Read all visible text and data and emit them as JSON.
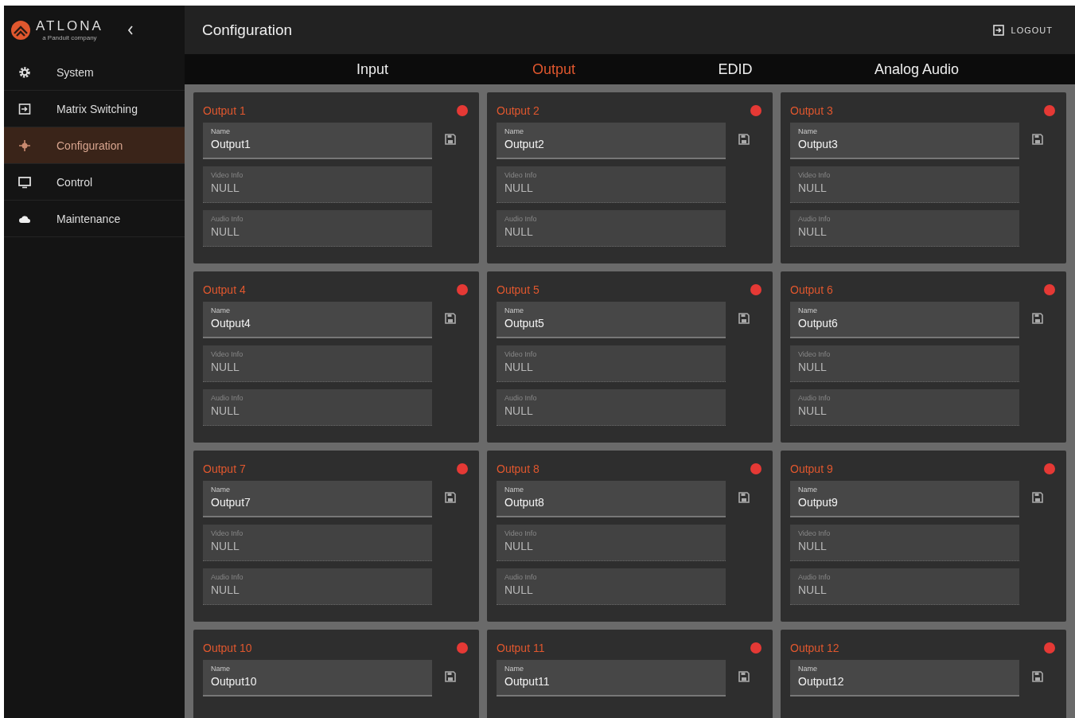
{
  "brand": {
    "name": "ATLONA",
    "tagline": "a Panduit company"
  },
  "sidebar": {
    "items": [
      {
        "label": "System",
        "selected": false
      },
      {
        "label": "Matrix Switching",
        "selected": false
      },
      {
        "label": "Configuration",
        "selected": true
      },
      {
        "label": "Control",
        "selected": false
      },
      {
        "label": "Maintenance",
        "selected": false
      }
    ]
  },
  "header": {
    "title": "Configuration",
    "logout": "LOGOUT"
  },
  "tabs": [
    {
      "label": "Input",
      "selected": false
    },
    {
      "label": "Output",
      "selected": true
    },
    {
      "label": "EDID",
      "selected": false
    },
    {
      "label": "Analog Audio",
      "selected": false
    }
  ],
  "outputs": [
    {
      "title": "Output 1",
      "color": "#e53935",
      "fields": [
        {
          "label": "Name",
          "value": "Output1",
          "disabled": false
        },
        {
          "label": "Video Info",
          "value": "NULL",
          "disabled": true
        },
        {
          "label": "Audio Info",
          "value": "NULL",
          "disabled": true
        }
      ]
    },
    {
      "title": "Output 2",
      "color": "#e53935",
      "fields": [
        {
          "label": "Name",
          "value": "Output2",
          "disabled": false
        },
        {
          "label": "Video Info",
          "value": "NULL",
          "disabled": true
        },
        {
          "label": "Audio Info",
          "value": "NULL",
          "disabled": true
        }
      ]
    },
    {
      "title": "Output 3",
      "color": "#e53935",
      "fields": [
        {
          "label": "Name",
          "value": "Output3",
          "disabled": false
        },
        {
          "label": "Video Info",
          "value": "NULL",
          "disabled": true
        },
        {
          "label": "Audio Info",
          "value": "NULL",
          "disabled": true
        }
      ]
    },
    {
      "title": "Output 4",
      "color": "#e53935",
      "fields": [
        {
          "label": "Name",
          "value": "Output4",
          "disabled": false
        },
        {
          "label": "Video Info",
          "value": "NULL",
          "disabled": true
        },
        {
          "label": "Audio Info",
          "value": "NULL",
          "disabled": true
        }
      ]
    },
    {
      "title": "Output 5",
      "color": "#e53935",
      "fields": [
        {
          "label": "Name",
          "value": "Output5",
          "disabled": false
        },
        {
          "label": "Video Info",
          "value": "NULL",
          "disabled": true
        },
        {
          "label": "Audio Info",
          "value": "NULL",
          "disabled": true
        }
      ]
    },
    {
      "title": "Output 6",
      "color": "#e53935",
      "fields": [
        {
          "label": "Name",
          "value": "Output6",
          "disabled": false
        },
        {
          "label": "Video Info",
          "value": "NULL",
          "disabled": true
        },
        {
          "label": "Audio Info",
          "value": "NULL",
          "disabled": true
        }
      ]
    },
    {
      "title": "Output 7",
      "color": "#e53935",
      "fields": [
        {
          "label": "Name",
          "value": "Output7",
          "disabled": false
        },
        {
          "label": "Video Info",
          "value": "NULL",
          "disabled": true
        },
        {
          "label": "Audio Info",
          "value": "NULL",
          "disabled": true
        }
      ]
    },
    {
      "title": "Output 8",
      "color": "#e53935",
      "fields": [
        {
          "label": "Name",
          "value": "Output8",
          "disabled": false
        },
        {
          "label": "Video Info",
          "value": "NULL",
          "disabled": true
        },
        {
          "label": "Audio Info",
          "value": "NULL",
          "disabled": true
        }
      ]
    },
    {
      "title": "Output 9",
      "color": "#e53935",
      "fields": [
        {
          "label": "Name",
          "value": "Output9",
          "disabled": false
        },
        {
          "label": "Video Info",
          "value": "NULL",
          "disabled": true
        },
        {
          "label": "Audio Info",
          "value": "NULL",
          "disabled": true
        }
      ]
    },
    {
      "title": "Output 10",
      "color": "#e53935",
      "fields": [
        {
          "label": "Name",
          "value": "Output10",
          "disabled": false
        }
      ]
    },
    {
      "title": "Output 11",
      "color": "#e53935",
      "fields": [
        {
          "label": "Name",
          "value": "Output11",
          "disabled": false
        }
      ]
    },
    {
      "title": "Output 12",
      "color": "#e53935",
      "fields": [
        {
          "label": "Name",
          "value": "Output12",
          "disabled": false
        }
      ]
    }
  ]
}
